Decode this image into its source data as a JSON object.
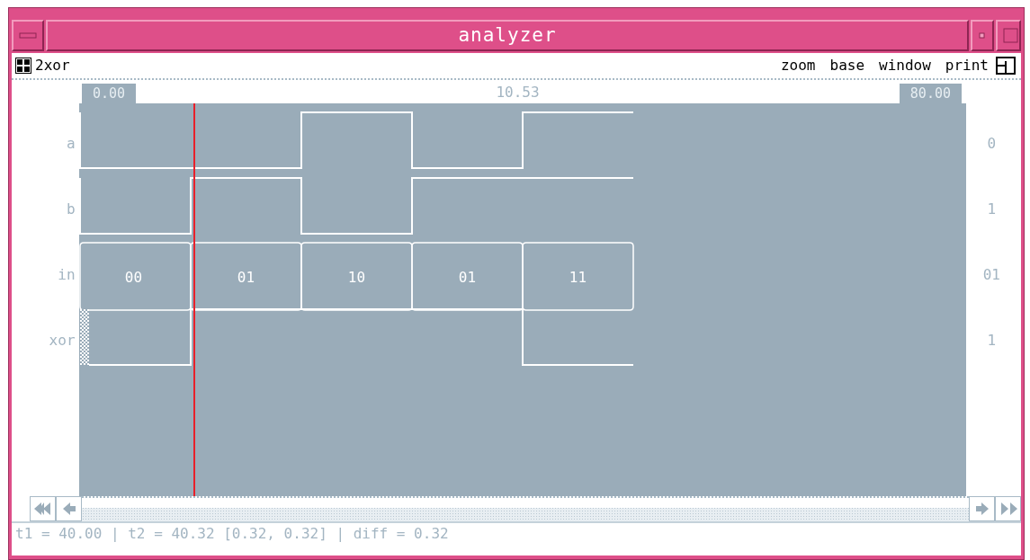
{
  "window": {
    "title": "analyzer"
  },
  "toolbar": {
    "name": "2xor",
    "menu": [
      "zoom",
      "base",
      "window",
      "print"
    ]
  },
  "time_axis": {
    "start": "0.00",
    "cursor": "10.53",
    "end": "80.00"
  },
  "signals": [
    {
      "name": "a",
      "kind": "bit",
      "value": "0",
      "segments": [
        {
          "kind": "low"
        },
        {
          "kind": "low"
        },
        {
          "kind": "high"
        },
        {
          "kind": "low"
        },
        {
          "kind": "high"
        }
      ]
    },
    {
      "name": "b",
      "kind": "bit",
      "value": "1",
      "segments": [
        {
          "kind": "low"
        },
        {
          "kind": "high"
        },
        {
          "kind": "low"
        },
        {
          "kind": "high"
        },
        {
          "kind": "high"
        }
      ]
    },
    {
      "name": "in",
      "kind": "bus",
      "value": "01",
      "segments": [
        {
          "label": "00"
        },
        {
          "label": "01"
        },
        {
          "label": "10"
        },
        {
          "label": "01"
        },
        {
          "label": "11"
        }
      ]
    },
    {
      "name": "xor",
      "kind": "bit",
      "value": "1",
      "segments": [
        {
          "kind": "unknown"
        },
        {
          "kind": "low"
        },
        {
          "kind": "high"
        },
        {
          "kind": "high"
        },
        {
          "kind": "high"
        },
        {
          "kind": "low"
        }
      ]
    }
  ],
  "status_bar": "t1 = 40.00 | t2 = 40.32 [0.32, 0.32] | diff = 0.32"
}
